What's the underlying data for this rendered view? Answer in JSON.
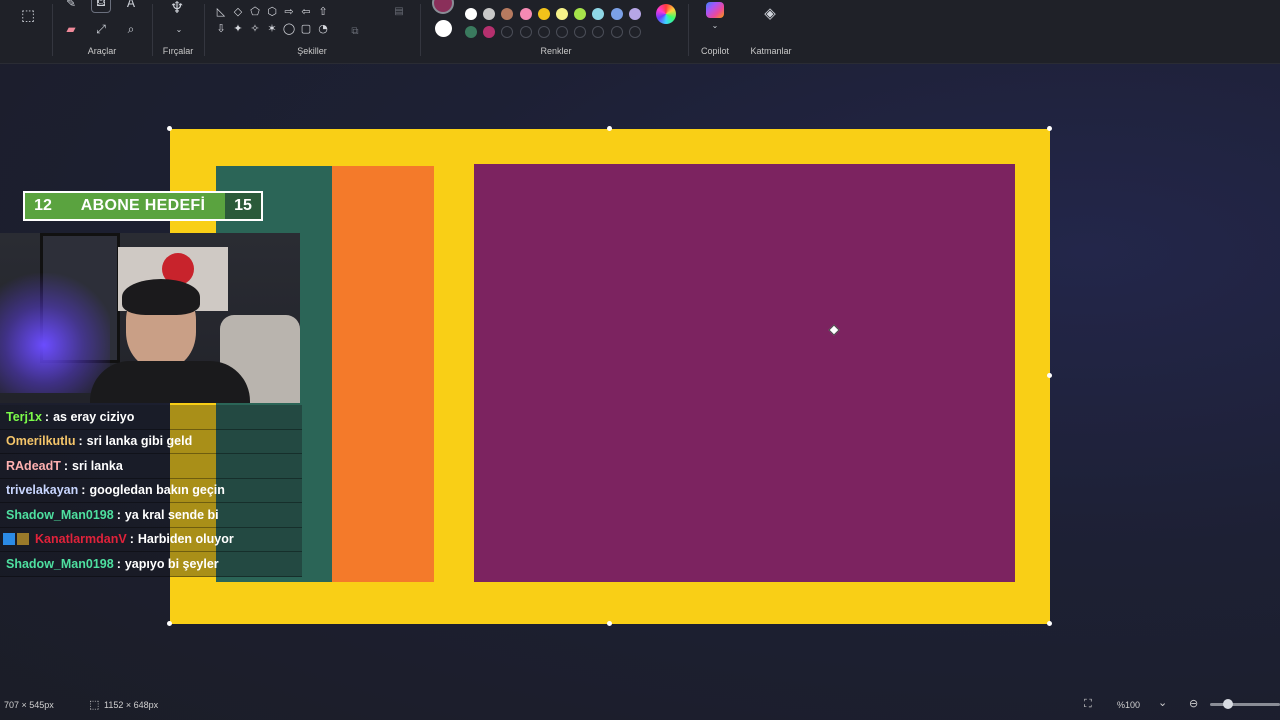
{
  "ribbon": {
    "groups": {
      "tools": "Araçlar",
      "brushes": "Fırçalar",
      "shapes": "Şekiller",
      "colors": "Renkler",
      "copilot": "Copilot",
      "layers": "Katmanlar"
    },
    "tool_icons": [
      "pencil-icon",
      "fill-icon",
      "text-icon",
      "eraser-icon",
      "color-picker-icon",
      "magnifier-icon"
    ],
    "shape_glyphs": [
      "◺",
      "◇",
      "⬠",
      "⬡",
      "⇨",
      "⇦",
      "⇧",
      "⇩",
      "✦",
      "✧",
      "✶",
      "◯",
      "▢",
      "◔"
    ],
    "active_color": "#8a2f5a",
    "secondary_color": "#ffffff",
    "palette_row1": [
      "#ffffff",
      "#c8c8c8",
      "#b67a5f",
      "#f58ab4",
      "#f2c21a",
      "#f6f28a",
      "#a6e34a",
      "#8fd7e6",
      "#7ba0e6",
      "#b6a6e6"
    ],
    "palette_row2": [
      "#3a7a5e",
      "#b5306e",
      "",
      "",
      "",
      "",
      "",
      "",
      "",
      ""
    ]
  },
  "canvas": {
    "background": "#f9cf16",
    "rects": [
      {
        "name": "teal-rectangle",
        "color": "#2b6557"
      },
      {
        "name": "orange-rectangle",
        "color": "#f47a2a"
      },
      {
        "name": "purple-rectangle",
        "color": "#7c2360"
      }
    ]
  },
  "overlay": {
    "goal_current": "12",
    "goal_label": "ABONE HEDEFİ",
    "goal_target": "15",
    "chat": [
      {
        "user": "Terj1x",
        "color": "#7cfc4a",
        "text": "as eray ciziyo",
        "badges": false
      },
      {
        "user": "Omerilkutlu",
        "color": "#f4c56a",
        "text": "sri lanka gibi geld",
        "badges": false
      },
      {
        "user": "RAdeadT",
        "color": "#ffb0b0",
        "text": "sri lanka",
        "badges": false
      },
      {
        "user": "trivelakayan",
        "color": "#c9d6ff",
        "text": "googledan bakın geçin",
        "badges": false
      },
      {
        "user": "Shadow_Man0198",
        "color": "#4ee0a0",
        "text": "ya kral sende bi",
        "badges": false
      },
      {
        "user": "KanatlarmdanV",
        "color": "#e0223a",
        "text": "Harbiden oluyor",
        "badges": true
      },
      {
        "user": "Shadow_Man0198",
        "color": "#4ee0a0",
        "text": "yapıyo bi şeyler",
        "badges": false
      }
    ]
  },
  "status": {
    "cursor_pos": "707 × 545px",
    "canvas_size": "1152 × 648px",
    "zoom": "%100"
  }
}
